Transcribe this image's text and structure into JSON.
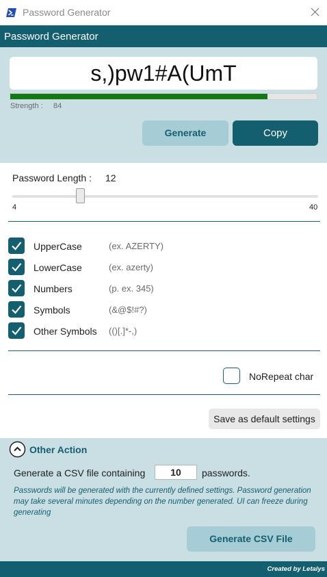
{
  "window": {
    "title": "Password Generator",
    "close_icon": "close-icon",
    "app_icon": "powershell-icon"
  },
  "header": {
    "title": "Password Generator"
  },
  "password": {
    "value": "s,)pw1#A(UmT"
  },
  "strength": {
    "label": "Strength :",
    "value": "84",
    "fraction": 0.84,
    "bar_color": "#117a14"
  },
  "actions": {
    "generate_label": "Generate",
    "copy_label": "Copy"
  },
  "length": {
    "label": "Password Length :",
    "value": "12",
    "min": "4",
    "max": "40"
  },
  "options": [
    {
      "label": "UpperCase",
      "hint": "(ex. AZERTY)",
      "checked": true
    },
    {
      "label": "LowerCase",
      "hint": "(ex. azerty)",
      "checked": true
    },
    {
      "label": "Numbers",
      "hint": "(p. ex. 345)",
      "checked": true
    },
    {
      "label": "Symbols",
      "hint": "(&@$!#?)",
      "checked": true
    },
    {
      "label": "Other Symbols",
      "hint": "(()[.]*-,)",
      "checked": true
    }
  ],
  "norepeat": {
    "label": "NoRepeat char",
    "checked": false
  },
  "save_default_label": "Save as default settings",
  "other_action": {
    "title": "Other Action",
    "expand_icon": "chevron-up-icon",
    "csv_prefix": "Generate a CSV file containing",
    "csv_count": "10",
    "csv_suffix": "passwords.",
    "note": "Passwords will be generated with the currently defined settings. Password generation may take several minutes depending on the number generated. UI can freeze during generating",
    "button_label": "Generate CSV File"
  },
  "footer": {
    "credit": "Created by Letalys"
  },
  "colors": {
    "accent": "#135e6f",
    "panel": "#c9dfe4",
    "button_light": "#a6cdd6"
  }
}
